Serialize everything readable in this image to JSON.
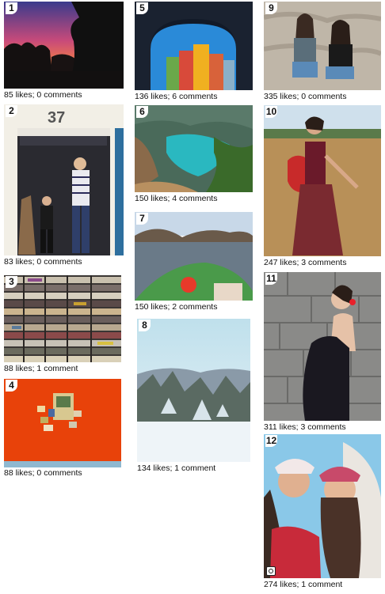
{
  "posts": [
    {
      "number": "1",
      "caption": "85 likes; 0 comments"
    },
    {
      "number": "2",
      "caption": "83 likes; 0 comments"
    },
    {
      "number": "3",
      "caption": "88 likes; 1 comment"
    },
    {
      "number": "4",
      "caption": "88 likes; 0 comments"
    },
    {
      "number": "5",
      "caption": "136 likes; 6 comments"
    },
    {
      "number": "6",
      "caption": "150 likes; 4 comments"
    },
    {
      "number": "7",
      "caption": "150 likes; 2 comments"
    },
    {
      "number": "8",
      "caption": "134 likes; 1 comment"
    },
    {
      "number": "9",
      "caption": "335 likes; 0 comments"
    },
    {
      "number": "10",
      "caption": "247 likes; 3 comments"
    },
    {
      "number": "11",
      "caption": "311 likes; 3 comments"
    },
    {
      "number": "12",
      "caption": "274 likes; 1 comment"
    }
  ],
  "icons": {
    "post12_overlay": "instagram-icon"
  }
}
